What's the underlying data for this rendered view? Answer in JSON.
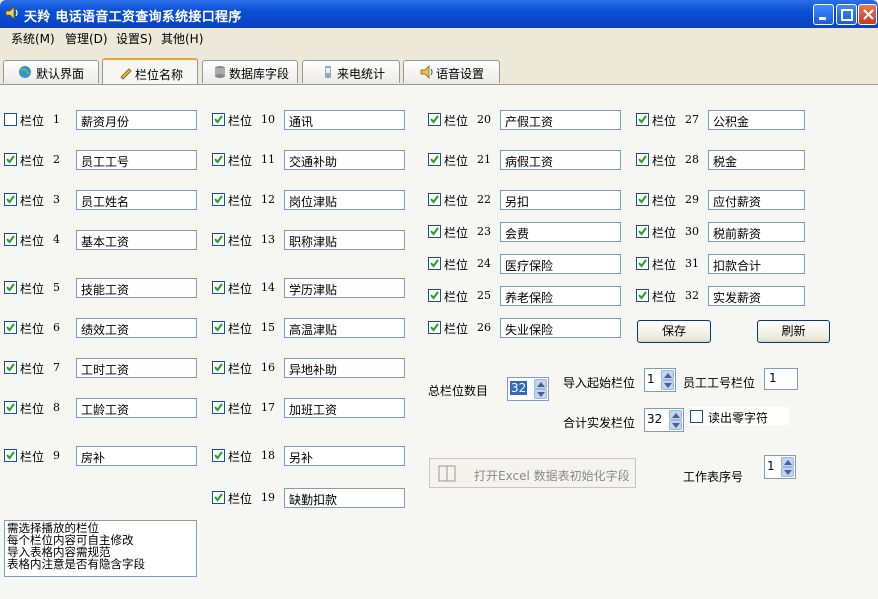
{
  "window": {
    "title": "天羚 电话语音工资查询系统接口程序"
  },
  "menu": [
    {
      "label": "系统(M)"
    },
    {
      "label": "管理(D)"
    },
    {
      "label": "设置S)"
    },
    {
      "label": "其他(H)"
    }
  ],
  "tabs": [
    {
      "label": "默认界面"
    },
    {
      "label": "栏位名称"
    },
    {
      "label": "数据库字段"
    },
    {
      "label": "来电统计"
    },
    {
      "label": "语音设置"
    }
  ],
  "field_prefix": "栏位",
  "fields": [
    {
      "num": "1",
      "value": "薪资月份",
      "checked": false
    },
    {
      "num": "2",
      "value": "员工工号",
      "checked": true
    },
    {
      "num": "3",
      "value": "员工姓名",
      "checked": true
    },
    {
      "num": "4",
      "value": "基本工资",
      "checked": true
    },
    {
      "num": "5",
      "value": "技能工资",
      "checked": true
    },
    {
      "num": "6",
      "value": "绩效工资",
      "checked": true
    },
    {
      "num": "7",
      "value": "工时工资",
      "checked": true
    },
    {
      "num": "8",
      "value": "工龄工资",
      "checked": true
    },
    {
      "num": "9",
      "value": "房补",
      "checked": true
    },
    {
      "num": "10",
      "value": "通讯",
      "checked": true
    },
    {
      "num": "11",
      "value": "交通补助",
      "checked": true
    },
    {
      "num": "12",
      "value": "岗位津贴",
      "checked": true
    },
    {
      "num": "13",
      "value": "职称津贴",
      "checked": true
    },
    {
      "num": "14",
      "value": "学历津贴",
      "checked": true
    },
    {
      "num": "15",
      "value": "高温津贴",
      "checked": true
    },
    {
      "num": "16",
      "value": "异地补助",
      "checked": true
    },
    {
      "num": "17",
      "value": "加班工资",
      "checked": true
    },
    {
      "num": "18",
      "value": "另补",
      "checked": true
    },
    {
      "num": "19",
      "value": "缺勤扣款",
      "checked": true
    },
    {
      "num": "20",
      "value": "产假工资",
      "checked": true
    },
    {
      "num": "21",
      "value": "病假工资",
      "checked": true
    },
    {
      "num": "22",
      "value": "另扣",
      "checked": true
    },
    {
      "num": "23",
      "value": "会费",
      "checked": true
    },
    {
      "num": "24",
      "value": "医疗保险",
      "checked": true
    },
    {
      "num": "25",
      "value": "养老保险",
      "checked": true
    },
    {
      "num": "26",
      "value": "失业保险",
      "checked": true
    },
    {
      "num": "27",
      "value": "公积金",
      "checked": true
    },
    {
      "num": "28",
      "value": "税金",
      "checked": true
    },
    {
      "num": "29",
      "value": "应付薪资",
      "checked": true
    },
    {
      "num": "30",
      "value": "税前薪资",
      "checked": true
    },
    {
      "num": "31",
      "value": "扣款合计",
      "checked": true
    },
    {
      "num": "32",
      "value": "实发薪资",
      "checked": true
    }
  ],
  "buttons": {
    "save": "保存",
    "refresh": "刷新",
    "open_excel": "打开Excel 数据表初始化字段"
  },
  "settings": {
    "total_label": "总栏位数目",
    "total_value": "32",
    "import_start_label": "导入起始栏位",
    "import_start_value": "1",
    "emp_id_label": "员工工号栏位",
    "emp_id_value": "1",
    "total_pay_label": "合计实发栏位",
    "total_pay_value": "32",
    "read_zero_label": "读出零字符",
    "sheet_label": "工作表序号",
    "sheet_value": "1"
  },
  "memo": [
    "需选择播放的栏位",
    "每个栏位内容可自主修改",
    "导入表格内容需规范",
    "表格内注意是否有隐含字段"
  ]
}
